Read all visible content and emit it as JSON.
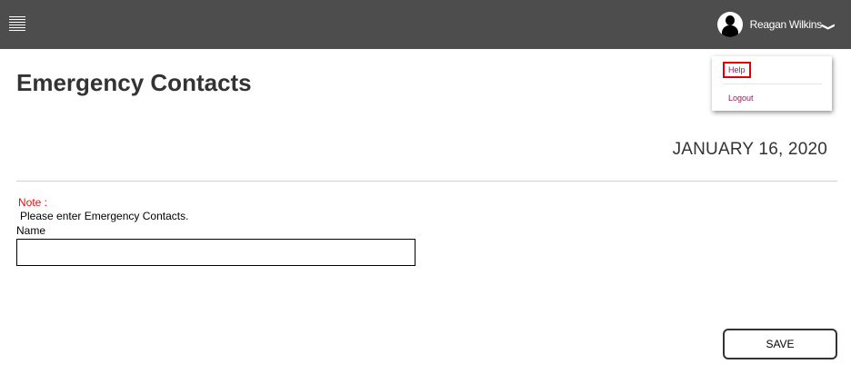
{
  "header": {
    "user_name": "Reagan Wilkins",
    "chevron": "❯"
  },
  "user_menu": {
    "items": [
      {
        "label": "Help"
      },
      {
        "label": "Logout"
      }
    ]
  },
  "page": {
    "title": "Emergency Contacts",
    "date": "JANUARY 16, 2020"
  },
  "form": {
    "note_label": "Note :",
    "note_text": "Please enter Emergency Contacts.",
    "name_label": "Name",
    "name_value": "",
    "save_label": "SAVE"
  },
  "colors": {
    "topbar": "#4d4d4d",
    "note": "#ff0000",
    "menu_link": "#8a1f5a",
    "highlight": "#e00000"
  },
  "icons": {
    "menu": "hamburger-menu-icon",
    "avatar": "user-avatar-icon",
    "dropdown": "chevron-down-icon"
  }
}
